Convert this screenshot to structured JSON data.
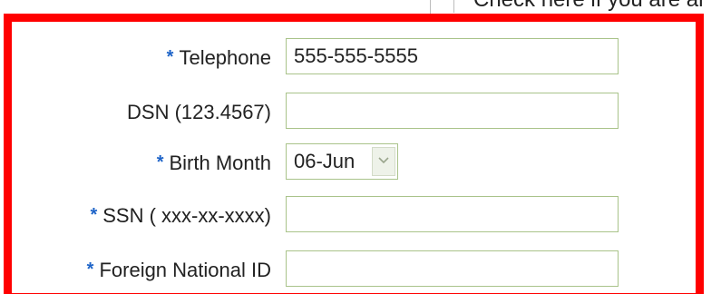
{
  "top": {
    "partial_text": "Check here if you are ar"
  },
  "form": {
    "required_marker": "*",
    "telephone": {
      "label": "Telephone",
      "required": true,
      "value": "555-555-5555"
    },
    "dsn": {
      "label": "DSN (123.4567)",
      "required": false,
      "value": ""
    },
    "birth_month": {
      "label": "Birth Month",
      "required": true,
      "selected": "06-Jun"
    },
    "ssn": {
      "label": "SSN ( xxx-xx-xxxx)",
      "required": true,
      "value": ""
    },
    "foreign_national_id": {
      "label": "Foreign National ID",
      "required": true,
      "value": ""
    }
  },
  "colors": {
    "highlight_border": "#ff0000",
    "required_marker": "#1e64c8",
    "field_border": "#a9c38a"
  },
  "icons": {
    "select_arrow": "chevron-down-icon"
  }
}
